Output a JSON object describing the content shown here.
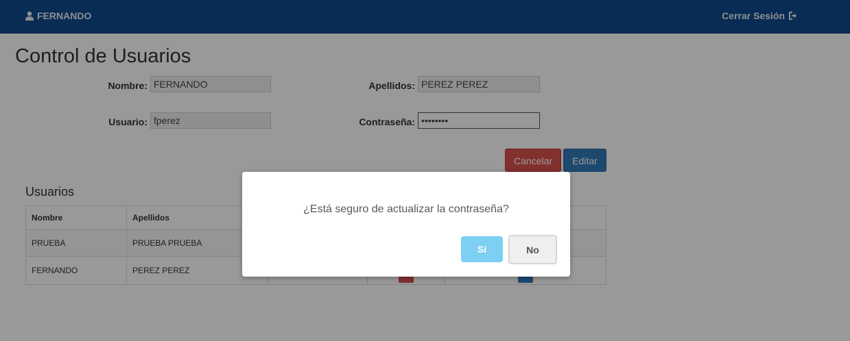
{
  "navbar": {
    "user_name": "FERNANDO",
    "logout_label": "Cerrar Sesión",
    "icons": {
      "user": "user-icon",
      "logout": "logout-icon"
    },
    "bg_color": "#0f4a8c"
  },
  "page": {
    "title": "Control de Usuarios"
  },
  "form": {
    "nombre_label": "Nombre:",
    "nombre_value": "FERNANDO",
    "apellidos_label": "Apellidos:",
    "apellidos_value": "PEREZ PEREZ",
    "usuario_label": "Usuario:",
    "usuario_value": "fperez",
    "contrasena_label": "Contraseña:",
    "contrasena_value": "••••••••",
    "cancel_label": "Cancelar",
    "edit_label": "Editar"
  },
  "users_section": {
    "title": "Usuarios",
    "columns": [
      "Nombre",
      "Apellidos",
      "",
      "",
      ""
    ],
    "rows": [
      {
        "nombre": "PRUEBA",
        "apellidos": "PRUEBA PRUEBA"
      },
      {
        "nombre": "FERNANDO",
        "apellidos": "PEREZ PEREZ"
      }
    ]
  },
  "modal": {
    "message": "¿Está seguro de actualizar la contraseña?",
    "yes_label": "Si",
    "no_label": "No"
  }
}
